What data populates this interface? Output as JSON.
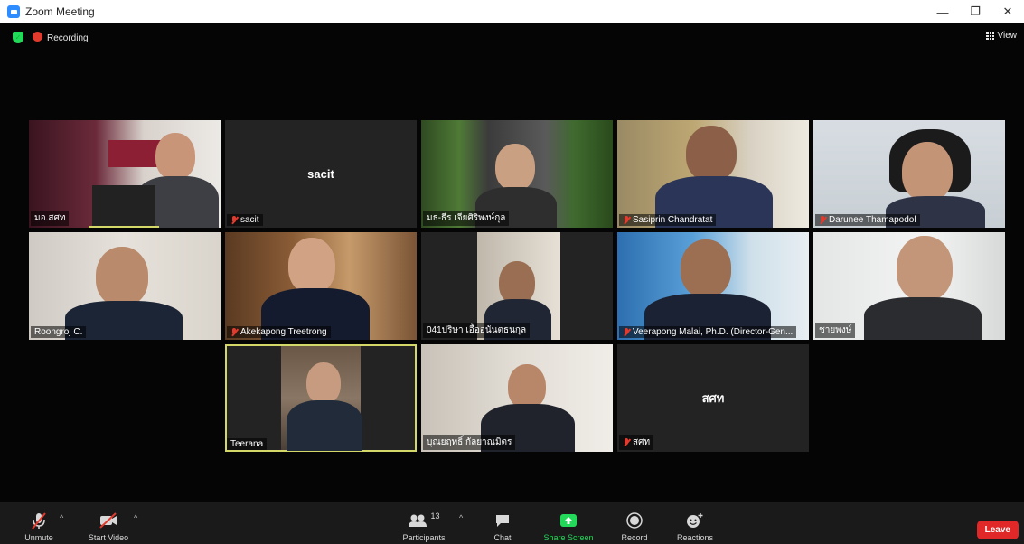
{
  "window": {
    "title": "Zoom Meeting",
    "minimize": "—",
    "restore": "❐",
    "close": "✕"
  },
  "meeting": {
    "recording_label": "Recording",
    "view_label": "View"
  },
  "tiles": [
    {
      "name": "มอ.สศท",
      "muted": false,
      "video": true
    },
    {
      "name": "sacit",
      "muted": true,
      "video": false,
      "display": "sacit"
    },
    {
      "name": "มธ-ธีร เจียศิริพงษ์กุล",
      "muted": false,
      "video": true
    },
    {
      "name": "Sasiprin Chandratat",
      "muted": true,
      "video": true
    },
    {
      "name": "Darunee Thamapodol",
      "muted": true,
      "video": true
    },
    {
      "name": "Roongroj C.",
      "muted": false,
      "video": true
    },
    {
      "name": "Akekapong Treetrong",
      "muted": true,
      "video": true
    },
    {
      "name": "041ปริษา เอื้ออนันตธนกุล",
      "muted": false,
      "video": true
    },
    {
      "name": "Veerapong Malai, Ph.D. (Director-Gen...",
      "muted": true,
      "video": true
    },
    {
      "name": "ชายพงษ์",
      "muted": false,
      "video": true
    },
    {
      "name": "Teerana",
      "muted": false,
      "video": true
    },
    {
      "name": "บุณยฤทธิ์ กัลยาณมิตร",
      "muted": false,
      "video": true
    },
    {
      "name": "สศท",
      "muted": true,
      "video": false,
      "display": "สศท"
    }
  ],
  "toolbar": {
    "unmute": "Unmute",
    "start_video": "Start Video",
    "participants": "Participants",
    "participants_count": "13",
    "chat": "Chat",
    "share_screen": "Share Screen",
    "record": "Record",
    "reactions": "Reactions",
    "leave": "Leave"
  },
  "colors": {
    "accent_green": "#23d959",
    "share_green": "#23d959",
    "leave_red": "#e02828",
    "active_speaker": "#d4d869"
  }
}
